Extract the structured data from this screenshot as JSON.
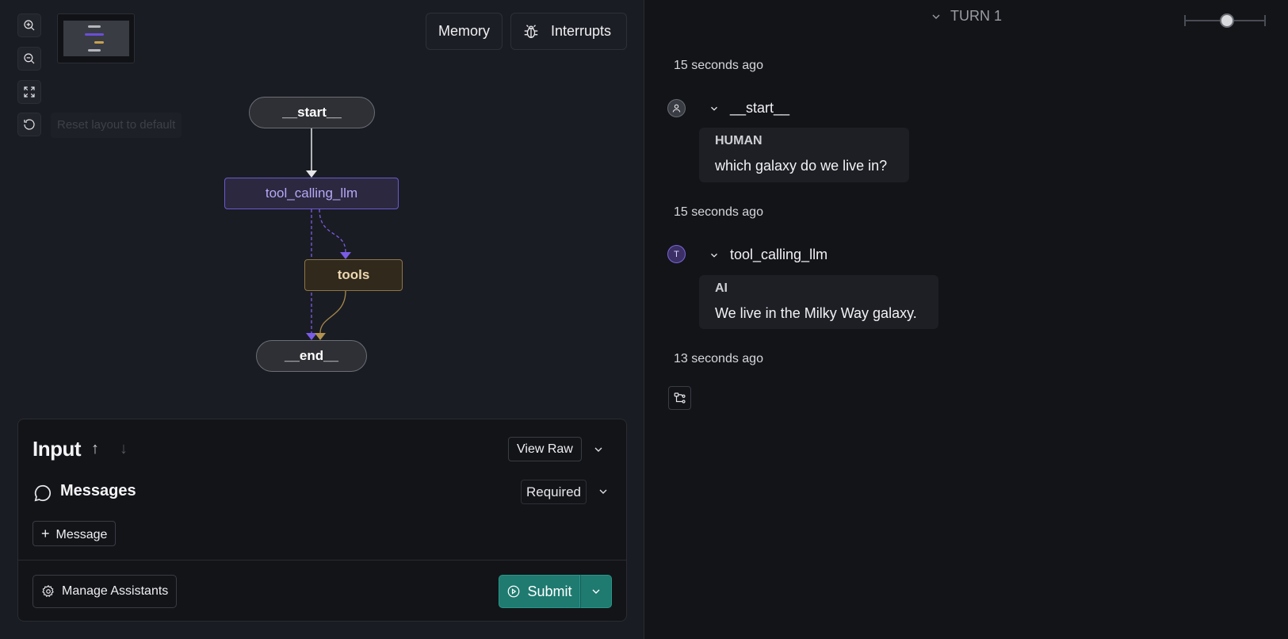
{
  "toolbar": {
    "reset_tooltip": "Reset layout to default",
    "memory_label": "Memory",
    "interrupts_label": "Interrupts"
  },
  "graph": {
    "nodes": {
      "start": "__start__",
      "llm": "tool_calling_llm",
      "tools": "tools",
      "end": "__end__"
    },
    "colors": {
      "llm_edge": "#7a5ce6",
      "tools_edge": "#a88a4c",
      "start_edge": "#e6e6ea"
    }
  },
  "input_panel": {
    "title": "Input",
    "view_raw_label": "View Raw",
    "messages_label": "Messages",
    "required_label": "Required",
    "add_message_label": "Message",
    "manage_assistants_label": "Manage Assistants",
    "submit_label": "Submit"
  },
  "run": {
    "turn_label": "TURN 1",
    "events": [
      {
        "time": "15 seconds ago",
        "node": "__start__",
        "avatar": "",
        "role": "HUMAN",
        "text": "which galaxy do we live in?"
      },
      {
        "time": "15 seconds ago",
        "node": "tool_calling_llm",
        "avatar": "T",
        "role": "AI",
        "text": "We live in the Milky Way galaxy."
      }
    ],
    "last_time": "13 seconds ago"
  }
}
